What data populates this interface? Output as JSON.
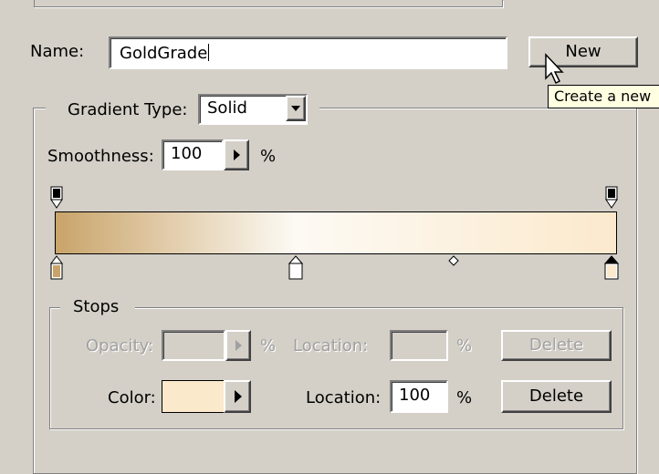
{
  "name": {
    "label": "Name:",
    "value": "GoldGrade"
  },
  "new_button": {
    "label": "New",
    "tooltip": "Create a new"
  },
  "gradient_type": {
    "label": "Gradient Type:",
    "value": "Solid"
  },
  "smoothness": {
    "label": "Smoothness:",
    "value": "100",
    "unit": "%"
  },
  "gradient": {
    "start_color": "#c9a46a",
    "mid_color": "#fdfaf4",
    "end_color": "#fbe9cc",
    "midpoint_percent": 71,
    "color_stops_percent": [
      0,
      43,
      100
    ],
    "selected_stop_percent": 100
  },
  "stops": {
    "legend": "Stops",
    "opacity": {
      "label": "Opacity:",
      "unit": "%",
      "location_label": "Location:",
      "location_unit": "%",
      "delete_label": "Delete"
    },
    "color": {
      "label": "Color:",
      "swatch": "#fbe9cc",
      "location_label": "Location:",
      "location_value": "100",
      "location_unit": "%",
      "delete_label": "Delete"
    }
  }
}
